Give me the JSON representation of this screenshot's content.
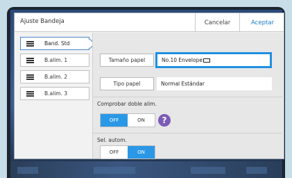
{
  "dialog": {
    "title": "Ajuste Bandeja",
    "cancel_label": "Cancelar",
    "accept_label": "Aceptar"
  },
  "trays": [
    {
      "label": "Band. Std",
      "selected": true,
      "icon": "tray-icon"
    },
    {
      "label": "B.alim. 1",
      "selected": false,
      "icon": "tray-icon"
    },
    {
      "label": "B.alim. 2",
      "selected": false,
      "icon": "tray-icon"
    },
    {
      "label": "B.alim. 3",
      "selected": false,
      "icon": "tray-icon"
    }
  ],
  "paper_size": {
    "button_label": "Tamaño papel",
    "value": "No.10 Envelope",
    "icon": "envelope-icon"
  },
  "paper_type": {
    "button_label": "Tipo papel",
    "value": "Normal Estándar"
  },
  "double_feed": {
    "label": "Comprobar doble alim.",
    "off_label": "OFF",
    "on_label": "ON",
    "selected": "OFF",
    "help_label": "?"
  },
  "auto_select": {
    "label": "Sel. autom.",
    "off_label": "OFF",
    "on_label": "ON",
    "selected": "ON"
  },
  "colors": {
    "accent": "#2a98e6",
    "accept_text": "#1a7ac8",
    "help": "#7b5cb8",
    "focus_border": "#2090e0"
  }
}
